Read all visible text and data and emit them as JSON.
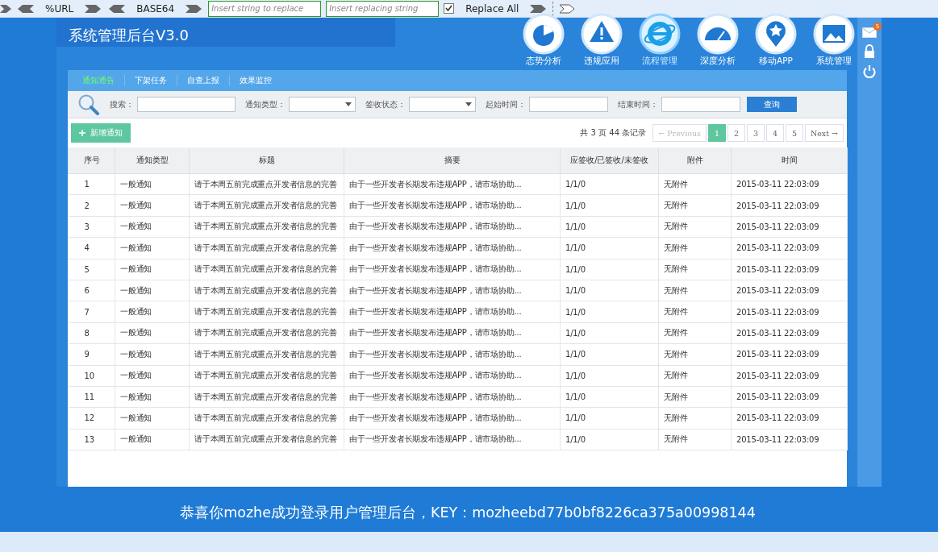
{
  "toolbar": {
    "buttons": [
      {
        "label": "%URL"
      },
      {
        "label": "BASE64"
      }
    ],
    "find_field": {
      "placeholder": "Insert string to replace"
    },
    "replace_field": {
      "placeholder": "Insert replacing string"
    },
    "replace_all": {
      "label": "Replace All",
      "checked": true
    }
  },
  "header": {
    "title": "系统管理后台V3.0",
    "nav": [
      {
        "label": "态势分析",
        "selected": false
      },
      {
        "label": "违规应用",
        "selected": false
      },
      {
        "label": "流程管理",
        "selected": true
      },
      {
        "label": "深度分析",
        "selected": false
      },
      {
        "label": "移动APP",
        "selected": false
      },
      {
        "label": "系统管理",
        "selected": false
      }
    ]
  },
  "sidebar": {
    "mail_badge": "5"
  },
  "tabs": [
    {
      "label": "通知通告",
      "selected": true
    },
    {
      "label": "下架任务",
      "selected": false
    },
    {
      "label": "自查上报",
      "selected": false
    },
    {
      "label": "效果监控",
      "selected": false
    }
  ],
  "filters": {
    "search_label": "搜索：",
    "type_label": "通知类型：",
    "status_label": "签收状态：",
    "start_label": "起始时间：",
    "end_label": "结束时间：",
    "query_button": "查询"
  },
  "add_button": "新增通知",
  "pagination": {
    "summary": "共 3 页 44 条记录",
    "previous": {
      "label": "← Previous",
      "disabled": true
    },
    "pages": [
      {
        "label": "1",
        "selected": true
      },
      {
        "label": "2",
        "selected": false
      },
      {
        "label": "3",
        "selected": false
      },
      {
        "label": "4",
        "selected": false
      },
      {
        "label": "5",
        "selected": false
      }
    ],
    "next": {
      "label": "Next →",
      "disabled": false
    }
  },
  "table": {
    "columns": [
      "序号",
      "通知类型",
      "标题",
      "摘要",
      "应签收/已签收/未签收",
      "附件",
      "时间"
    ],
    "rows": [
      [
        "1",
        "一般通知",
        "请于本周五前完成重点开发者信息的完善",
        "由于一些开发者长期发布违规APP，请市场协助...",
        "1/1/0",
        "无附件",
        "2015-03-11 22:03:09"
      ],
      [
        "2",
        "一般通知",
        "请于本周五前完成重点开发者信息的完善",
        "由于一些开发者长期发布违规APP，请市场协助...",
        "1/1/0",
        "无附件",
        "2015-03-11 22:03:09"
      ],
      [
        "3",
        "一般通知",
        "请于本周五前完成重点开发者信息的完善",
        "由于一些开发者长期发布违规APP，请市场协助...",
        "1/1/0",
        "无附件",
        "2015-03-11 22:03:09"
      ],
      [
        "4",
        "一般通知",
        "请于本周五前完成重点开发者信息的完善",
        "由于一些开发者长期发布违规APP，请市场协助...",
        "1/1/0",
        "无附件",
        "2015-03-11 22:03:09"
      ],
      [
        "5",
        "一般通知",
        "请于本周五前完成重点开发者信息的完善",
        "由于一些开发者长期发布违规APP，请市场协助...",
        "1/1/0",
        "无附件",
        "2015-03-11 22:03:09"
      ],
      [
        "6",
        "一般通知",
        "请于本周五前完成重点开发者信息的完善",
        "由于一些开发者长期发布违规APP，请市场协助...",
        "1/1/0",
        "无附件",
        "2015-03-11 22:03:09"
      ],
      [
        "7",
        "一般通知",
        "请于本周五前完成重点开发者信息的完善",
        "由于一些开发者长期发布违规APP，请市场协助...",
        "1/1/0",
        "无附件",
        "2015-03-11 22:03:09"
      ],
      [
        "8",
        "一般通知",
        "请于本周五前完成重点开发者信息的完善",
        "由于一些开发者长期发布违规APP，请市场协助...",
        "1/1/0",
        "无附件",
        "2015-03-11 22:03:09"
      ],
      [
        "9",
        "一般通知",
        "请于本周五前完成重点开发者信息的完善",
        "由于一些开发者长期发布违规APP，请市场协助...",
        "1/1/0",
        "无附件",
        "2015-03-11 22:03:09"
      ],
      [
        "10",
        "一般通知",
        "请于本周五前完成重点开发者信息的完善",
        "由于一些开发者长期发布违规APP，请市场协助...",
        "1/1/0",
        "无附件",
        "2015-03-11 22:03:09"
      ],
      [
        "11",
        "一般通知",
        "请于本周五前完成重点开发者信息的完善",
        "由于一些开发者长期发布违规APP，请市场协助...",
        "1/1/0",
        "无附件",
        "2015-03-11 22:03:09"
      ],
      [
        "12",
        "一般通知",
        "请于本周五前完成重点开发者信息的完善",
        "由于一些开发者长期发布违规APP，请市场协助...",
        "1/1/0",
        "无附件",
        "2015-03-11 22:03:09"
      ],
      [
        "13",
        "一般通知",
        "请于本周五前完成重点开发者信息的完善",
        "由于一些开发者长期发布违规APP，请市场协助...",
        "1/1/0",
        "无附件",
        "2015-03-11 22:03:09"
      ]
    ]
  },
  "footer": "恭喜你mozhe成功登录用户管理后台，KEY：mozheebd77b0bf8226ca375a00998144"
}
